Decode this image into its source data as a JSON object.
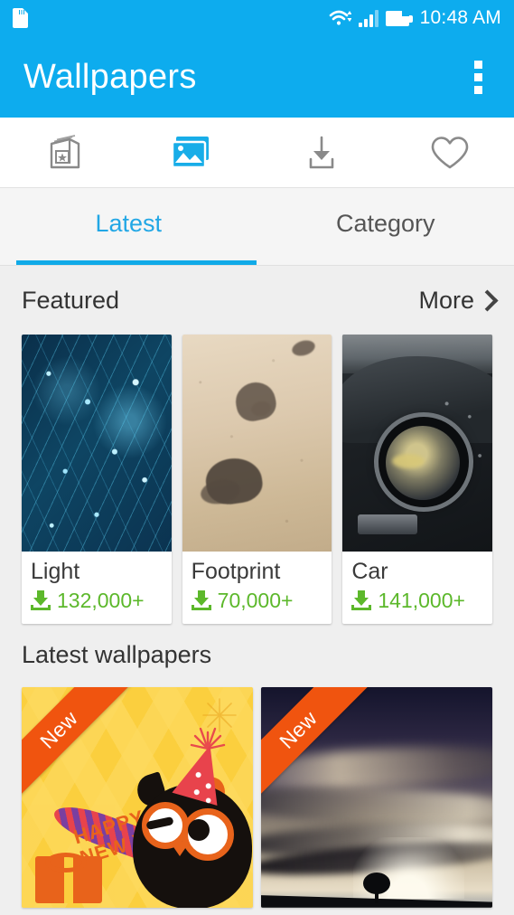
{
  "status_bar": {
    "time": "10:48 AM",
    "icons": [
      "sd-card-icon",
      "wifi-icon",
      "signal-icon",
      "battery-icon"
    ]
  },
  "app_bar": {
    "title": "Wallpapers",
    "overflow_menu": "overflow-menu-icon"
  },
  "icon_tabs": [
    {
      "name": "themes-box-icon",
      "label": "Themes",
      "active": false
    },
    {
      "name": "wallpapers-gallery-icon",
      "label": "Wallpapers",
      "active": true
    },
    {
      "name": "downloads-icon",
      "label": "Downloads",
      "active": false
    },
    {
      "name": "favorites-heart-icon",
      "label": "Favorites",
      "active": false
    }
  ],
  "text_tabs": [
    {
      "label": "Latest",
      "active": true
    },
    {
      "label": "Category",
      "active": false
    }
  ],
  "featured_section": {
    "title": "Featured",
    "more_label": "More",
    "items": [
      {
        "name": "Light",
        "downloads": "132,000+",
        "art": "circuit"
      },
      {
        "name": "Footprint",
        "downloads": "70,000+",
        "art": "sand"
      },
      {
        "name": "Car",
        "downloads": "141,000+",
        "art": "car"
      }
    ]
  },
  "latest_section": {
    "title": "Latest wallpapers",
    "items": [
      {
        "badge": "New",
        "art": "owl-new-year",
        "caption_line1": "HAPPY",
        "caption_line2": "NEW YEAR"
      },
      {
        "badge": "New",
        "art": "storm-clouds"
      }
    ]
  },
  "colors": {
    "primary_blue": "#0DACEE",
    "tab_active_blue": "#22A7E5",
    "download_green": "#5CB82B",
    "ribbon_orange": "#F0540F",
    "page_background": "#EFEFEF"
  }
}
